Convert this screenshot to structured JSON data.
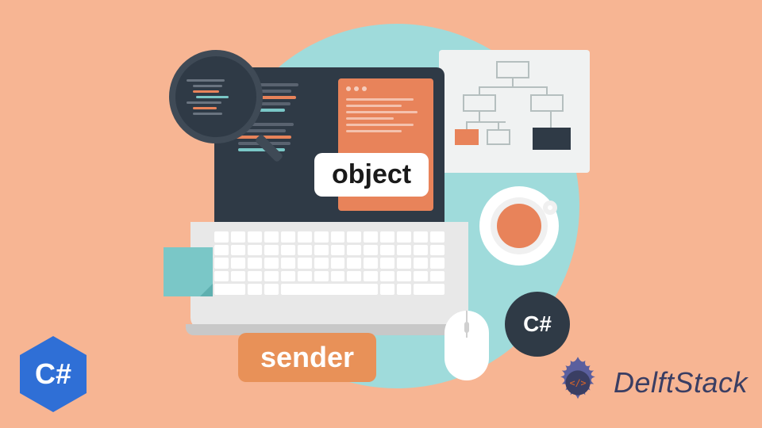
{
  "labels": {
    "object": "object",
    "sender": "sender"
  },
  "badges": {
    "csharp_circle": "C#",
    "csharp_hex": "C#"
  },
  "brand": {
    "name": "DelftStack"
  },
  "colors": {
    "background": "#f7b593",
    "circle": "#9fdbdb",
    "accent_orange": "#e8835a",
    "dark": "#2f3a46",
    "teal": "#7ac7c7",
    "brand_blue": "#2f6fd6",
    "brand_text": "#3a3e63"
  }
}
